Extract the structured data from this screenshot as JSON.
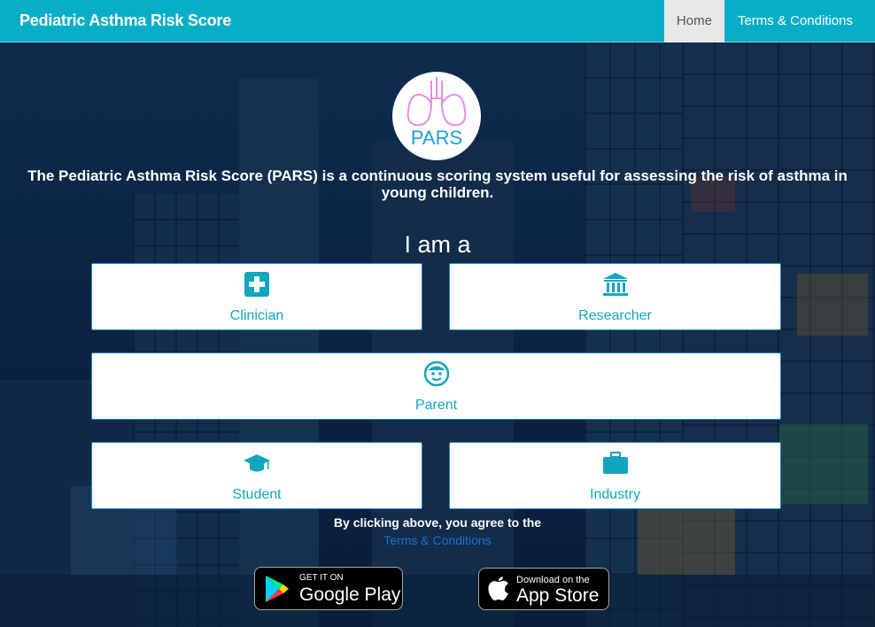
{
  "navbar": {
    "brand": "Pediatric Asthma Risk Score",
    "links": [
      {
        "label": "Home",
        "active": true
      },
      {
        "label": "Terms & Conditions",
        "active": false
      }
    ]
  },
  "logo": {
    "text": "PARS",
    "icon": "lungs-icon"
  },
  "intro": "The Pediatric Asthma Risk Score (PARS) is a continuous scoring system useful for assessing the risk of asthma in young children.",
  "prompt": "I am a",
  "roles": [
    {
      "label": "Clinician",
      "icon": "medical-cross-icon"
    },
    {
      "label": "Researcher",
      "icon": "institution-icon"
    },
    {
      "label": "Parent",
      "icon": "child-face-icon"
    },
    {
      "label": "Student",
      "icon": "graduation-cap-icon"
    },
    {
      "label": "Industry",
      "icon": "briefcase-icon"
    }
  ],
  "agreement": {
    "text": "By clicking above, you agree to the",
    "link": "Terms & Conditions"
  },
  "stores": {
    "google": {
      "small": "GET IT ON",
      "big": "Google Play"
    },
    "apple": {
      "small": "Download on the",
      "big": "App Store"
    }
  },
  "colors": {
    "brand": "#08aec8",
    "accent": "#11a6bd",
    "link": "#1d6fcf"
  }
}
